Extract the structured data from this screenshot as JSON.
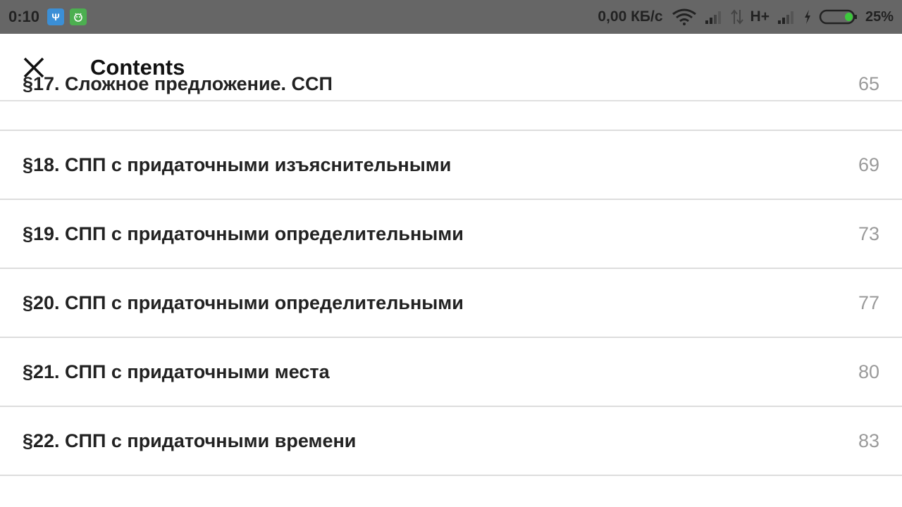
{
  "status_bar": {
    "time": "0:10",
    "notif_usb_icon": "usb-icon",
    "notif_bug_icon": "debug-icon",
    "net_speed": "0,00 КБ/с",
    "network_type": "H+",
    "battery_percent": "25%",
    "battery_level": 0.25,
    "battery_color": "#3cc83c"
  },
  "app_bar": {
    "close_icon": "close-icon",
    "title": "Contents"
  },
  "toc": {
    "items": [
      {
        "title": "§17. Сложное предложение. ССП",
        "page": "65"
      },
      {
        "title": "§18. СПП с придаточными изъяснительными",
        "page": "69"
      },
      {
        "title": "§19. СПП с придаточными определительными",
        "page": "73"
      },
      {
        "title": "§20. СПП с придаточными определительными",
        "page": "77"
      },
      {
        "title": "§21. СПП с придаточными места",
        "page": "80"
      },
      {
        "title": "§22. СПП с придаточными времени",
        "page": "83"
      }
    ]
  }
}
